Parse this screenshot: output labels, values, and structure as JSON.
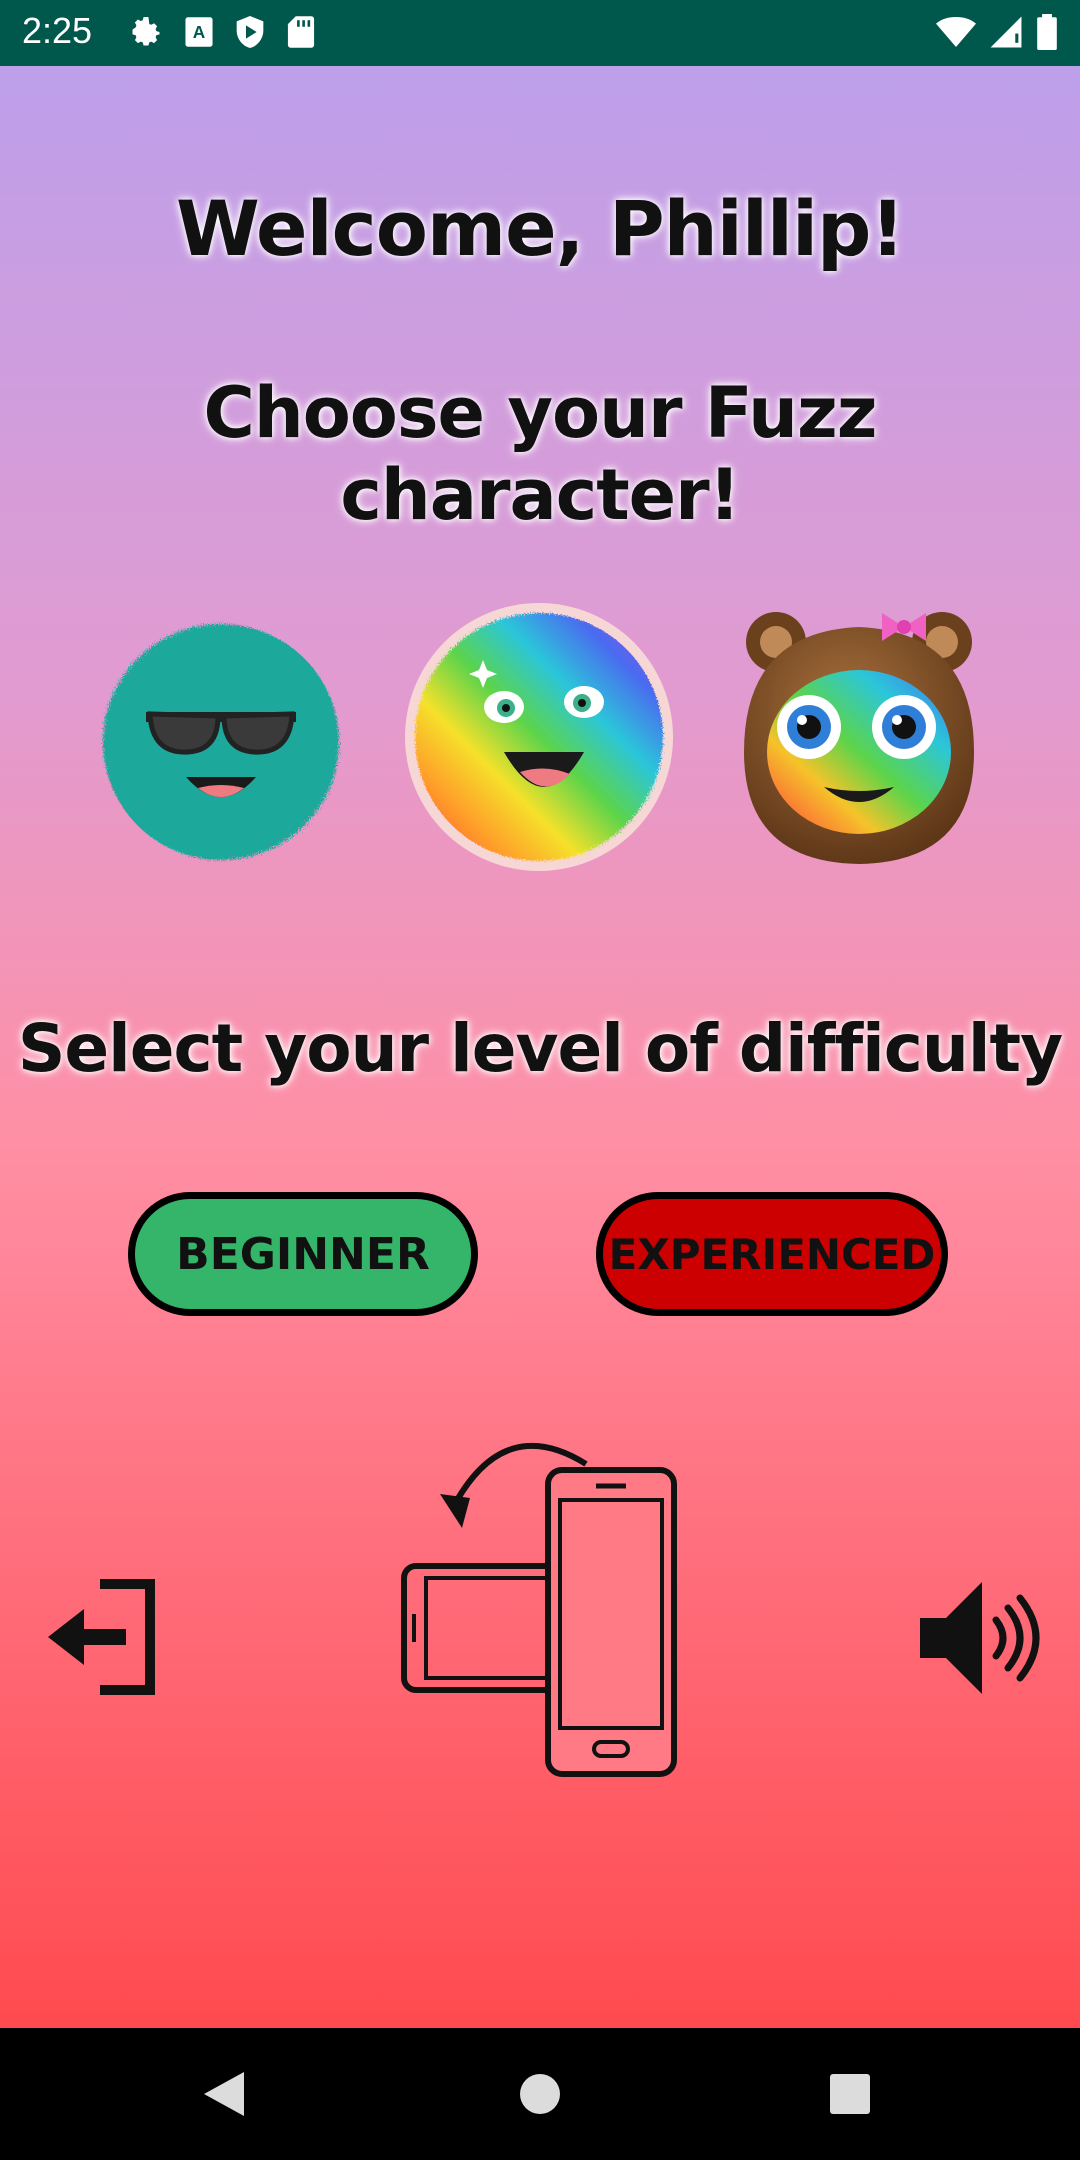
{
  "status_bar": {
    "time": "2:25",
    "left_icons": [
      "settings-icon",
      "a-keyboard-icon",
      "play-protect-icon",
      "sd-card-icon"
    ],
    "right_icons": [
      "wifi-icon",
      "cell-signal-icon",
      "battery-icon"
    ],
    "background": "#00574b"
  },
  "main": {
    "welcome_text": "Welcome, Phillip!",
    "choose_text": "Choose your Fuzz character!",
    "characters": [
      {
        "name": "teal-fuzz-sunglasses",
        "color": "#1fa89a"
      },
      {
        "name": "rainbow-fuzz",
        "color": "rainbow"
      },
      {
        "name": "rainbow-fuzz-bear-hood",
        "color": "#7a4a22"
      }
    ],
    "difficulty_prompt": "Select your level of difficulty",
    "buttons": {
      "beginner": "BEGINNER",
      "experienced": "EXPERIENCED"
    },
    "colors": {
      "beginner": "#35b56a",
      "experienced": "#cc0000"
    },
    "icons": [
      "logout-icon",
      "rotate-phone-icon",
      "volume-icon"
    ]
  },
  "nav_bar": {
    "buttons": [
      "back-icon",
      "home-icon",
      "recents-icon"
    ]
  }
}
